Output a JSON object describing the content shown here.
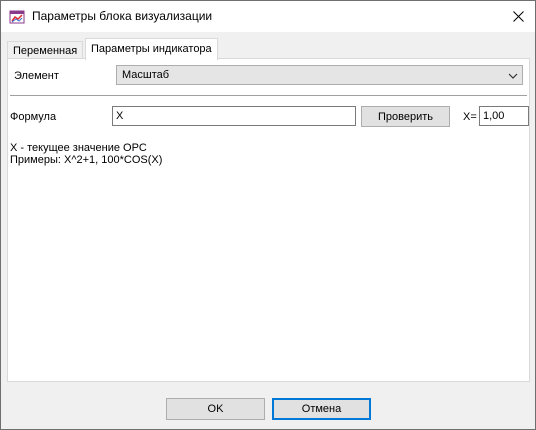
{
  "window": {
    "title": "Параметры блока визуализации",
    "icon": "app-window-icon"
  },
  "tabs": [
    {
      "label": "Переменная",
      "active": false
    },
    {
      "label": "Параметры индикатора",
      "active": true
    }
  ],
  "element": {
    "label": "Элемент",
    "selected": "Масштаб"
  },
  "formula": {
    "label": "Формула",
    "value": "X",
    "check_button": "Проверить",
    "x_label": "X=",
    "x_value": "1,00"
  },
  "hints": {
    "line1": "X - текущее значение OPC",
    "line2": "Примеры: X^2+1, 100*COS(X)"
  },
  "footer": {
    "ok_label": "OK",
    "cancel_label": "Отмена"
  },
  "colors": {
    "accent": "#0078d7",
    "dialog_bg": "#f0f0f0"
  }
}
